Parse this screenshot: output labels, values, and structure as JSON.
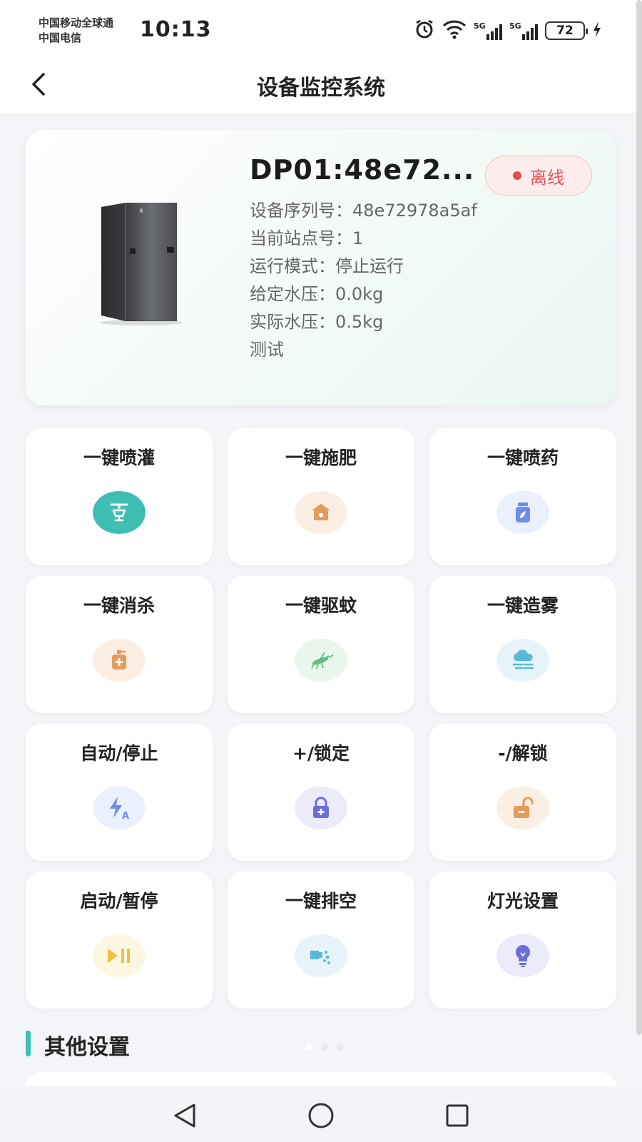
{
  "status_bar": {
    "carrier_1": "中国移动全球通",
    "carrier_2": "中国电信",
    "time": "10:13",
    "sim_1_network": "5G",
    "sim_2_network": "5G",
    "battery": "72",
    "icons": [
      "alarm-icon",
      "wifi-icon",
      "signal-icon",
      "signal-icon",
      "battery-icon",
      "charging-icon"
    ]
  },
  "header": {
    "title": "设备监控系统",
    "back_icon": "chevron-left-icon"
  },
  "device": {
    "name": "DP01:48e72...",
    "status": "离线",
    "status_color": "#e25656",
    "info": [
      "设备序列号：48e72978a5af",
      "当前站点号：1",
      "运行模式：停止运行",
      "给定水压：0.0kg",
      "实际水压：0.5kg",
      "测试"
    ]
  },
  "functions": [
    {
      "label": "一键喷灌",
      "icon": "sprinkler-icon",
      "color": "#3fbfb3"
    },
    {
      "label": "一键施肥",
      "icon": "fertilizer-icon",
      "color": "#e59a5c"
    },
    {
      "label": "一键喷药",
      "icon": "medicine-bottle-icon",
      "color": "#6f8de8"
    },
    {
      "label": "一键消杀",
      "icon": "disinfect-icon",
      "color": "#e59a5c"
    },
    {
      "label": "一键驱蚊",
      "icon": "mosquito-icon",
      "color": "#5fc07a"
    },
    {
      "label": "一键造雾",
      "icon": "fog-icon",
      "color": "#5ab8d8"
    },
    {
      "label": "自动/停止",
      "icon": "auto-icon",
      "color": "#6f8de8"
    },
    {
      "label": "+/锁定",
      "icon": "lock-icon",
      "color": "#6a6fd8"
    },
    {
      "label": "-/解锁",
      "icon": "unlock-icon",
      "color": "#e59a5c"
    },
    {
      "label": "启动/暂停",
      "icon": "play-pause-icon",
      "color": "#f0c040"
    },
    {
      "label": "一键排空",
      "icon": "drain-icon",
      "color": "#5ab8d8"
    },
    {
      "label": "灯光设置",
      "icon": "light-bulb-icon",
      "color": "#6a6fd8"
    }
  ],
  "section": {
    "title": "其他设置"
  },
  "nav": {
    "icons": [
      "back-triangle-icon",
      "home-circle-icon",
      "recents-square-icon"
    ]
  }
}
